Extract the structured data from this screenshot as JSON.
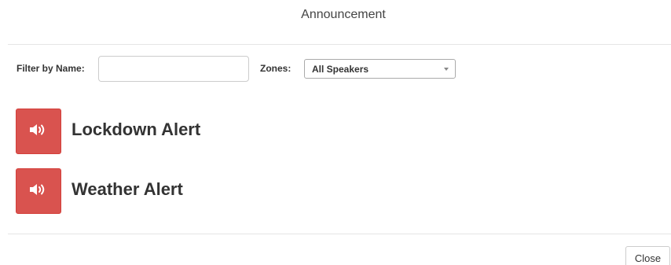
{
  "modal": {
    "title": "Announcement"
  },
  "filter": {
    "label": "Filter by Name:",
    "value": "",
    "placeholder": ""
  },
  "zones": {
    "label": "Zones:",
    "selected": "All Speakers"
  },
  "alerts": [
    {
      "label": "Lockdown Alert",
      "icon": "speaker-volume-icon"
    },
    {
      "label": "Weather Alert",
      "icon": "speaker-volume-icon"
    }
  ],
  "footer": {
    "close_label": "Close"
  },
  "colors": {
    "alert_button": "#d9534f",
    "alert_border": "#d43f3a"
  }
}
